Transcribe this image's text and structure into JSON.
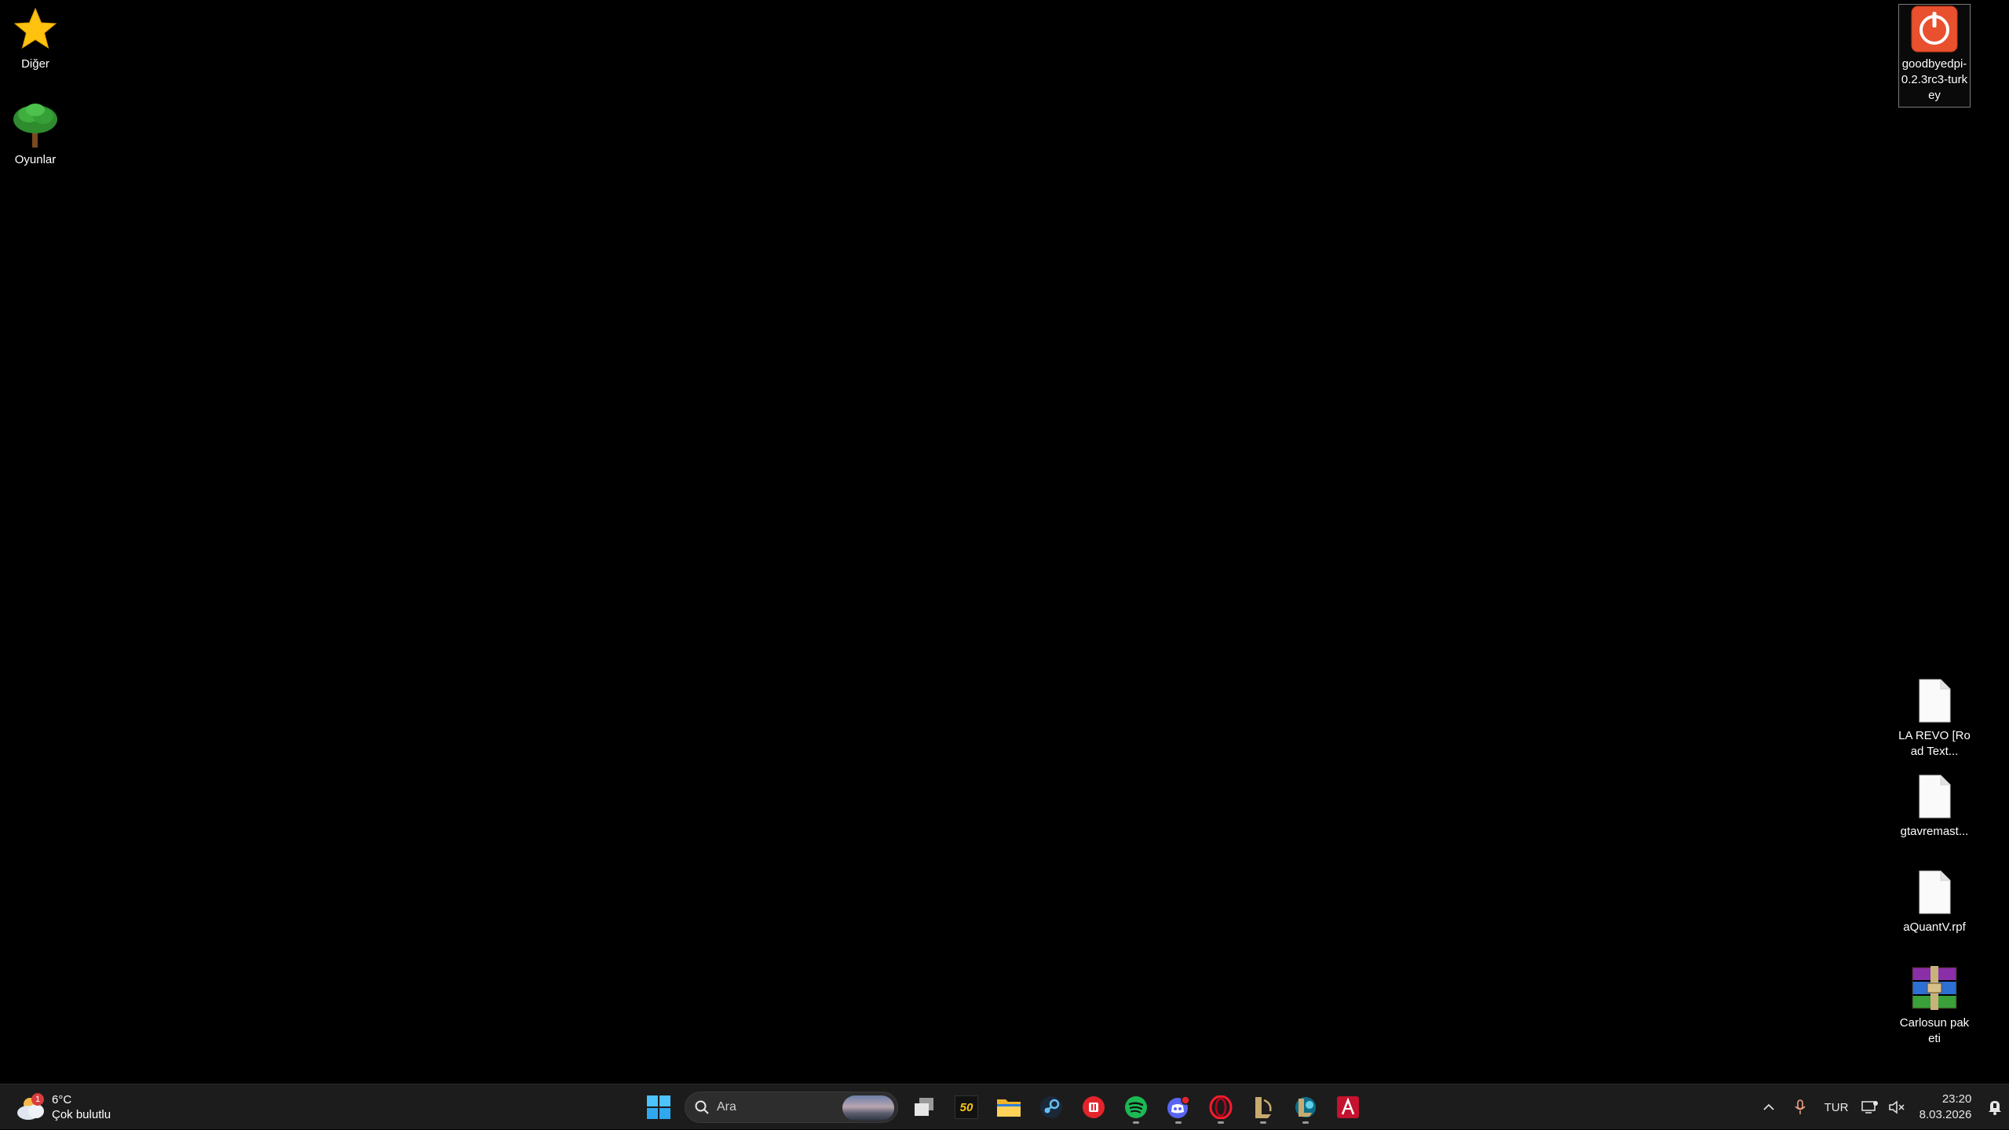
{
  "desktop": {
    "left_icons": [
      {
        "label": "Diğer",
        "icon": "star-icon"
      },
      {
        "label": "Oyunlar",
        "icon": "tree-icon"
      }
    ],
    "right_icons": [
      {
        "label": "goodbyedpi-0.2.3rc3-turkey",
        "icon": "power-icon"
      },
      {
        "label": "LA REVO [Road Text...",
        "icon": "file-icon"
      },
      {
        "label": "gtavremast...",
        "icon": "file-icon"
      },
      {
        "label": "aQuantV.rpf",
        "icon": "file-icon"
      },
      {
        "label": "Carlosun paketi",
        "icon": "winrar-archive-icon"
      }
    ]
  },
  "taskbar": {
    "weather": {
      "temperature": "6°C",
      "condition": "Çok bulutlu",
      "badge": "1"
    },
    "search": {
      "placeholder": "Ara"
    },
    "apps": [
      {
        "name": "start",
        "icon": "windows-start-icon"
      },
      {
        "name": "task-view",
        "icon": "task-view-icon"
      },
      {
        "name": "app-50",
        "icon": "app-50-icon",
        "text": "50"
      },
      {
        "name": "file-explorer",
        "icon": "folder-icon"
      },
      {
        "name": "steam",
        "icon": "steam-icon"
      },
      {
        "name": "red-app",
        "icon": "red-app-icon"
      },
      {
        "name": "spotify",
        "icon": "spotify-icon",
        "running": true
      },
      {
        "name": "discord",
        "icon": "discord-icon",
        "running": true
      },
      {
        "name": "opera",
        "icon": "opera-icon",
        "running": true
      },
      {
        "name": "league-client",
        "icon": "league-icon",
        "running": true
      },
      {
        "name": "game-client",
        "icon": "game-client-icon",
        "running": true
      },
      {
        "name": "red-a-app",
        "icon": "red-a-icon"
      }
    ],
    "tray": {
      "language": "TUR",
      "time": "23:20",
      "date": "8.03.2026"
    }
  },
  "colors": {
    "desktop_bg": "#000000",
    "taskbar_bg": "#1c1c1c",
    "spotify": "#1db954",
    "discord": "#5865f2",
    "notification_red": "#d83b3b"
  }
}
